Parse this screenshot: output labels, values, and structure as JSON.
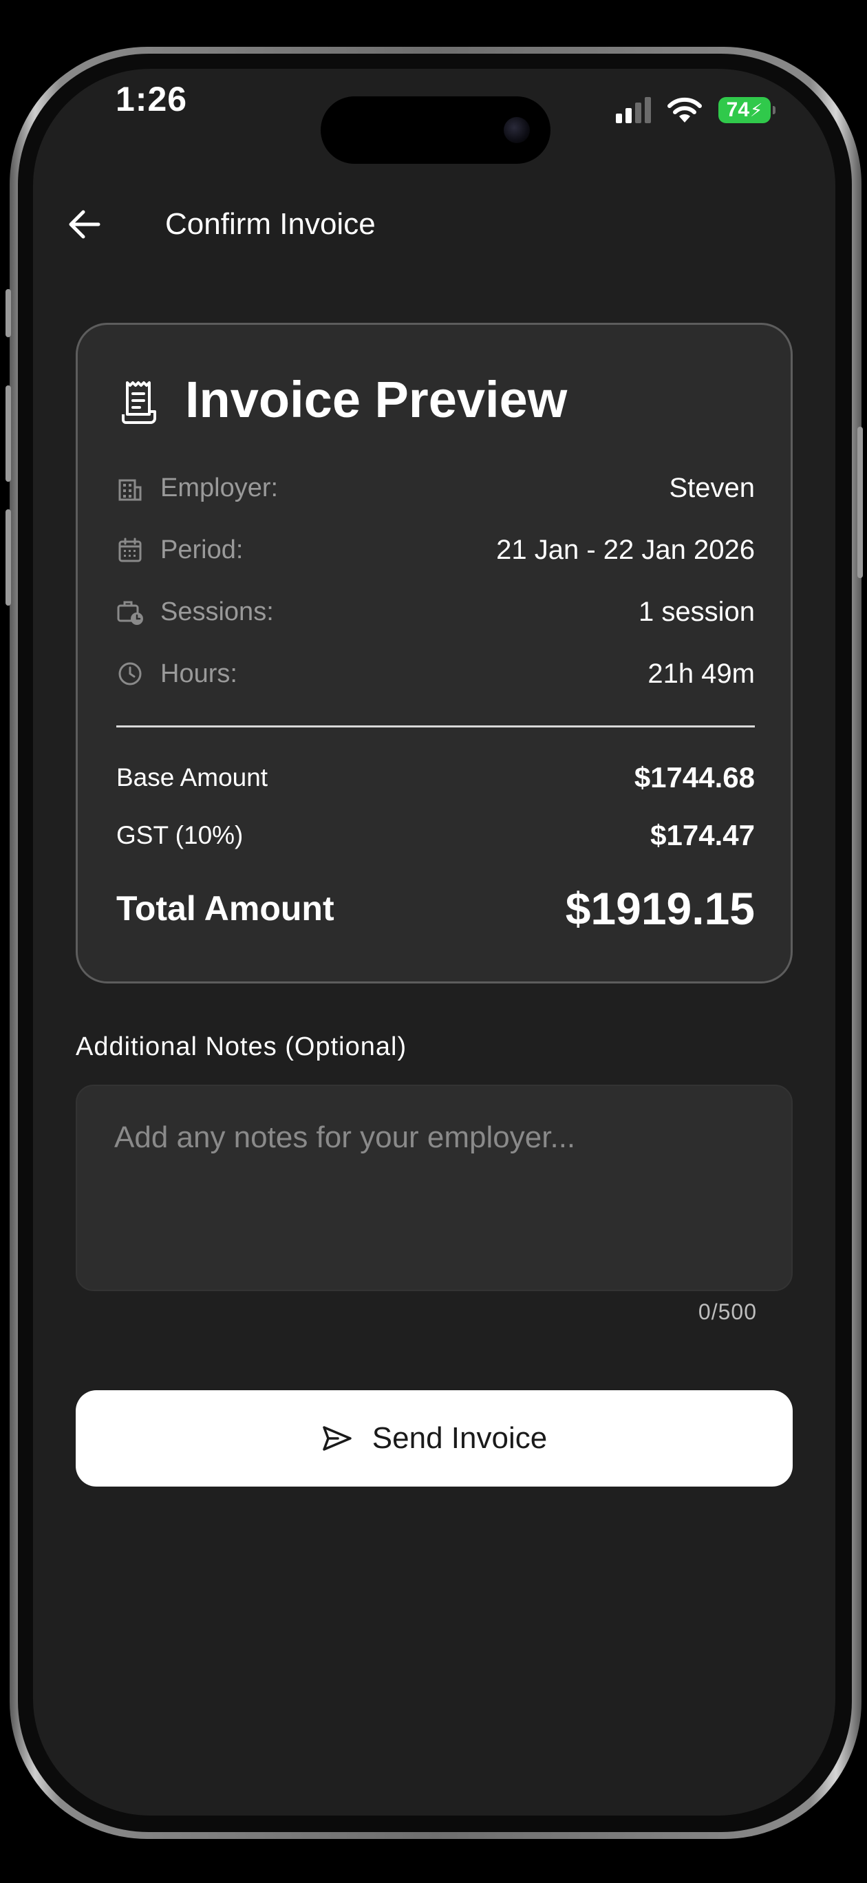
{
  "status_bar": {
    "time": "1:26",
    "battery_level": "74",
    "battery_color": "#30c94b"
  },
  "header": {
    "title": "Confirm Invoice",
    "back_icon": "arrow-left-icon"
  },
  "invoice_card": {
    "title": "Invoice Preview",
    "icon": "receipt-icon",
    "details": [
      {
        "icon": "building-icon",
        "label": "Employer:",
        "value": "Steven"
      },
      {
        "icon": "calendar-icon",
        "label": "Period:",
        "value": "21 Jan - 22 Jan 2026"
      },
      {
        "icon": "briefcase-clock-icon",
        "label": "Sessions:",
        "value": "1 session"
      },
      {
        "icon": "clock-icon",
        "label": "Hours:",
        "value": "21h 49m"
      }
    ],
    "base_amount": {
      "label": "Base Amount",
      "value": "$1744.68"
    },
    "gst": {
      "label": "GST (10%)",
      "value": "$174.47"
    },
    "total": {
      "label": "Total Amount",
      "value": "$1919.15"
    }
  },
  "notes": {
    "label": "Additional Notes (Optional)",
    "placeholder": "Add any notes for your employer...",
    "value": "",
    "char_count": "0/500"
  },
  "send_button": {
    "label": "Send Invoice",
    "icon": "send-icon"
  }
}
